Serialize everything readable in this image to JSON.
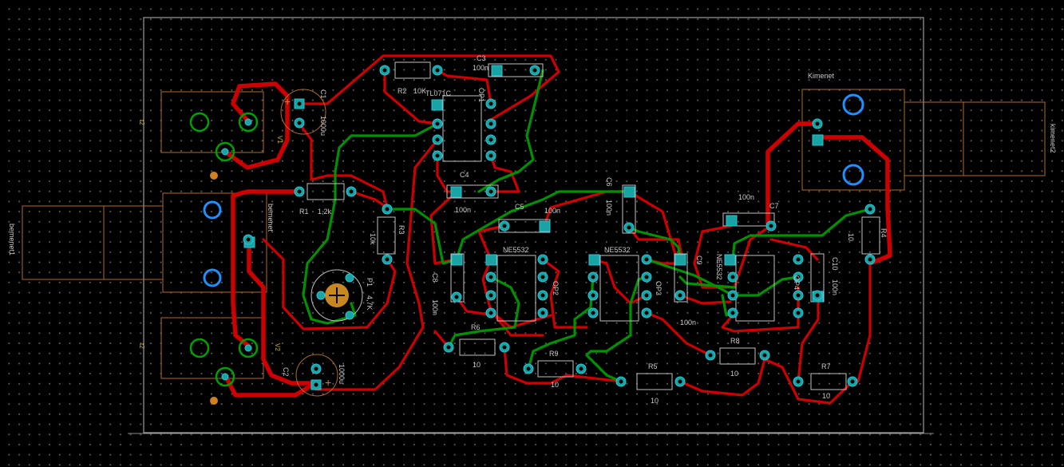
{
  "board_labels": {
    "C1": "C1",
    "C1_val": "1000u",
    "C2": "C2",
    "C2_val": "1000u",
    "V1": "V1",
    "V2": "V2",
    "t2a": "t2",
    "t2b": "t2",
    "bemenet": "bemenet",
    "bemenet1": "bemenet1",
    "R1": "R1",
    "R1_val": "1,2k",
    "R2": "R2",
    "R2_val": "10K",
    "R3": "R3",
    "R3_val": "10k",
    "P1": "P1",
    "P1_val": "4,7K",
    "TL071": "TL071C",
    "OP1": "OP1",
    "C3": "C3",
    "C3_val": "100n",
    "C4": "C4",
    "C4_val": "100n",
    "C5": "C5",
    "C5_val": "100n",
    "C6": "C6",
    "C6_val": "100n",
    "C7": "C7",
    "C7_val": "100n",
    "C8": "C8",
    "C8_val": "100n",
    "C9": "C9",
    "C9_val": "100n",
    "C10": "C10",
    "C10_val": "100n",
    "NE1": "NE5532",
    "OP2": "OP2",
    "NE2": "NE5532",
    "OP3": "OP3",
    "NE3": "NE5532",
    "OP4": "OP4",
    "R4": "R4",
    "R4_val": "10",
    "R5": "R5",
    "R5_val": "10",
    "R6": "R6",
    "R6_val": "10",
    "R7": "R7",
    "R7_val": "10",
    "R8": "R8",
    "R8_val": "10",
    "R9": "R9",
    "R9_val": "10",
    "kimenet": "Kimenet",
    "kimenet2": "kimenet2"
  },
  "colors": {
    "bottom_trace": "#cc0000",
    "top_trace": "#009000",
    "pad": "#1aa3a3",
    "mount_hole": "#1e90ff"
  }
}
